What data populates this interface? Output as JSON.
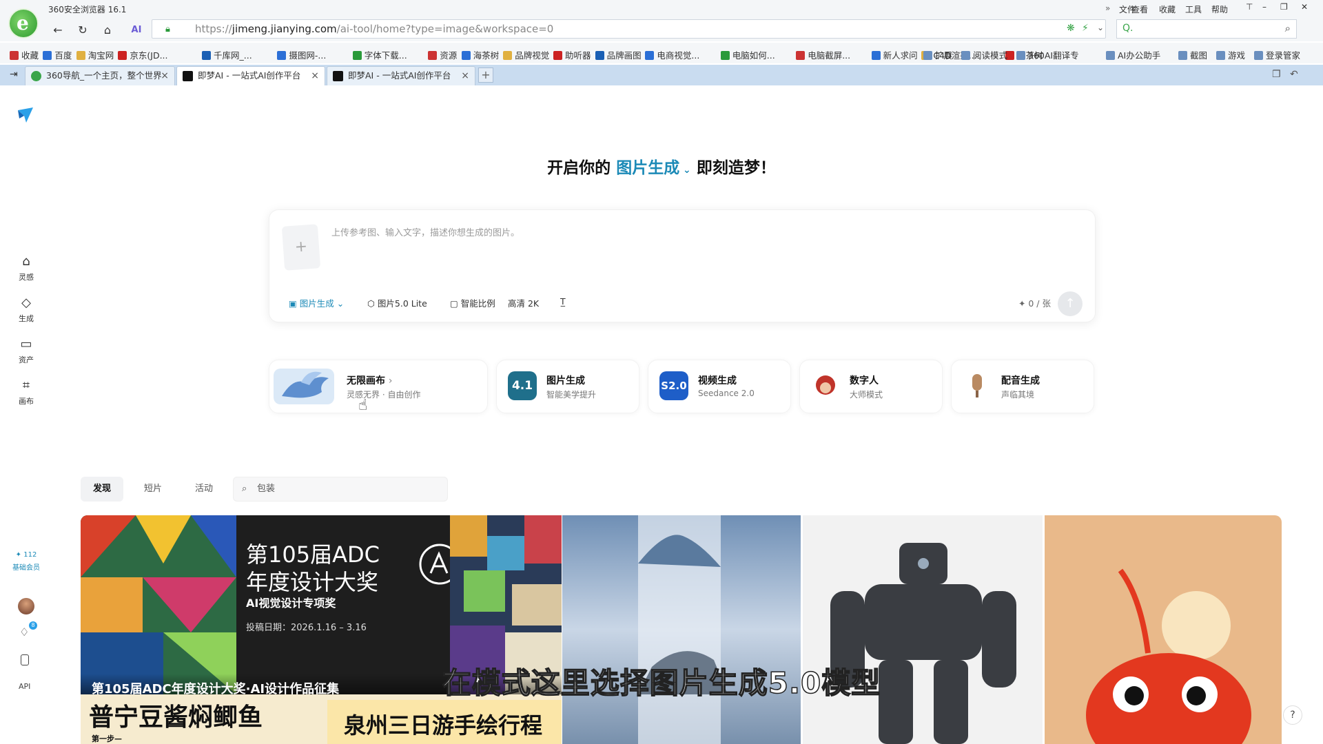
{
  "browser": {
    "title": "360安全浏览器 16.1",
    "menu": [
      "文件",
      "查看",
      "收藏",
      "工具",
      "帮助"
    ],
    "url_scheme": "https://",
    "url_host": "jimeng.jianying.com",
    "url_path": "/ai-tool/home?type=image&workspace=0",
    "search_placeholder": "Q.",
    "bookmarks": [
      "收藏",
      "百度",
      "淘宝网",
      "京东(JD...",
      "千库网_...",
      "摄图网-...",
      "字体下载...",
      "资源",
      "海茶树",
      "品牌视觉",
      "助听器",
      "品牌画图",
      "电商视觉...",
      "电脑如何...",
      "电脑截屏...",
      "新人求问",
      "C4D渲染...",
      "海茶树"
    ],
    "bookmarks_right": [
      "扩展",
      "阅读模式",
      "360AI翻译专",
      "AI办公助手",
      "截图",
      "游戏",
      "登录管家"
    ],
    "tabs": [
      "360导航_一个主页，整个世界",
      "即梦AI - 一站式AI创作平台",
      "即梦AI - 一站式AI创作平台"
    ]
  },
  "sidebar": {
    "items": [
      "灵感",
      "生成",
      "资产",
      "画布"
    ],
    "credits": "✦ 112",
    "member": "基础会员",
    "api": "API",
    "notif_count": "8"
  },
  "hero": {
    "prefix": "开启你的",
    "accent": "图片生成",
    "suffix": "即刻造梦！"
  },
  "composer": {
    "placeholder": "上传参考图、输入文字，描述你想生成的图片。",
    "mode": "图片生成",
    "model": "图片5.0 Lite",
    "ratio": "智能比例",
    "quality": "高清 2K",
    "credits": "✦ 0 / 张"
  },
  "features": [
    {
      "title": "无限画布",
      "sub": "灵感无界 · 自由创作"
    },
    {
      "title": "图片生成",
      "sub": "智能美学提升",
      "badge": "4.1"
    },
    {
      "title": "视频生成",
      "sub": "Seedance 2.0",
      "badge": "S2.0"
    },
    {
      "title": "数字人",
      "sub": "大师模式"
    },
    {
      "title": "配音生成",
      "sub": "声临其境"
    }
  ],
  "discover": {
    "tabs": [
      "发现",
      "短片",
      "活动"
    ],
    "search_value": "包装"
  },
  "gallery": {
    "adc_title1": "第105届ADC",
    "adc_title2": "年度设计大奖",
    "adc_sub": "AI视觉设计专项奖",
    "adc_date": "投稿日期：2026.1.16 – 3.16",
    "adc_caption": "第105届ADC年度设计大奖·AI设计作品征集",
    "card2": "普宁豆酱焖鲫鱼",
    "card3": "泉州三日游手绘行程",
    "card2_sub": "第一步—"
  },
  "subtitle": "在模式这里选择图片生成5.0模型",
  "colors": {
    "accent": "#1c8ab7",
    "dark": "#111111"
  }
}
